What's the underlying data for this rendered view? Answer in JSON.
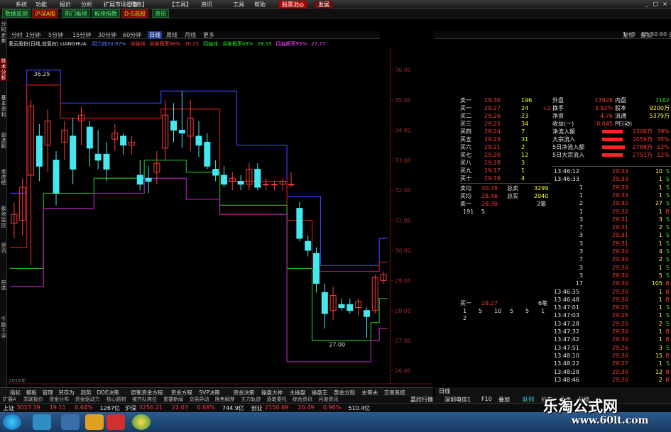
{
  "menubar": {
    "items": [
      "系统",
      "功能",
      "报价",
      "分析",
      "扩展市场行情",
      "【信息】",
      "【工具】",
      "资讯",
      "工具",
      "帮助"
    ],
    "promo": "股票池◎",
    "promo2": "发展"
  },
  "toolbar": {
    "items": [
      {
        "label": "数据监测",
        "style": "green"
      },
      {
        "label": "沪深A股",
        "style": "red"
      },
      {
        "label": "热门板块",
        "style": "green"
      },
      {
        "label": "板块指数",
        "style": "green"
      },
      {
        "label": "D-S选股",
        "style": "red"
      },
      {
        "label": "资讯",
        "style": "green"
      }
    ]
  },
  "left_tabs": [
    "分时走势",
    "技术分析",
    "基本资料",
    "自选股",
    "龙虎榜",
    "板块监控",
    "资讯",
    "自选",
    "千股千评"
  ],
  "periods": [
    "分时",
    "1分钟",
    "5分钟",
    "15分钟",
    "30分钟",
    "60分钟",
    "日线",
    "周线",
    "月线",
    "更多"
  ],
  "selected_period": "日线",
  "right_toolbar": [
    "1",
    "5",
    "15",
    "30",
    "60",
    "日",
    "周",
    "月",
    "复权",
    "叠加"
  ],
  "info": {
    "name": "爱云股份(日线,前复权) LIANGHUA",
    "indicators": [
      {
        "text": "阻力线30.97%",
        "color": "#5e78ff"
      },
      {
        "text": "突破线",
        "color": "#ff3b3b"
      },
      {
        "text": "突破概率68%",
        "color": "#ff3b3b"
      },
      {
        "text": "30.25",
        "color": "#ff3b3b"
      },
      {
        "text": "回抽线",
        "color": "#27e327"
      },
      {
        "text": "突破概率68%",
        "color": "#27e327"
      },
      {
        "text": "28.35",
        "color": "#27e327"
      },
      {
        "text": "回抽概率95%",
        "color": "#ff45ff"
      },
      {
        "text": "27.77",
        "color": "#ff45ff"
      }
    ]
  },
  "chart_data": {
    "type": "candlestick",
    "y_ticks": [
      "36.00",
      "35.00",
      "34.00",
      "33.00",
      "32.00",
      "31.00",
      "30.00",
      "29.00",
      "28.00",
      "27.00",
      "26.00"
    ],
    "ylim": [
      25.8,
      36.7
    ],
    "annotations": [
      {
        "text": "36.25"
      },
      {
        "text": "27.00"
      }
    ],
    "date_label": "2016年",
    "candles": [
      {
        "o": 30.9,
        "h": 31.6,
        "l": 30.4,
        "c": 31.2
      },
      {
        "o": 31.0,
        "h": 32.4,
        "l": 30.5,
        "c": 32.1
      },
      {
        "o": 32.5,
        "h": 35.0,
        "l": 29.5,
        "c": 34.8
      },
      {
        "o": 33.8,
        "h": 34.2,
        "l": 32.3,
        "c": 32.8
      },
      {
        "o": 33.5,
        "h": 34.7,
        "l": 32.6,
        "c": 34.3
      },
      {
        "o": 33.0,
        "h": 33.3,
        "l": 31.5,
        "c": 31.9
      },
      {
        "o": 33.6,
        "h": 34.3,
        "l": 33.0,
        "c": 34.0
      },
      {
        "o": 33.8,
        "h": 34.4,
        "l": 32.2,
        "c": 32.7
      },
      {
        "o": 34.3,
        "h": 34.8,
        "l": 33.5,
        "c": 34.5
      },
      {
        "o": 34.1,
        "h": 34.3,
        "l": 32.8,
        "c": 33.4
      },
      {
        "o": 33.2,
        "h": 34.0,
        "l": 32.7,
        "c": 33.0
      },
      {
        "o": 33.2,
        "h": 33.6,
        "l": 32.3,
        "c": 32.7
      },
      {
        "o": 33.7,
        "h": 34.2,
        "l": 33.3,
        "c": 33.9
      },
      {
        "o": 33.8,
        "h": 33.9,
        "l": 33.2,
        "c": 33.5
      },
      {
        "o": 33.5,
        "h": 33.8,
        "l": 33.2,
        "c": 33.6
      },
      {
        "o": 32.5,
        "h": 33.0,
        "l": 32.0,
        "c": 32.2
      },
      {
        "o": 32.4,
        "h": 32.8,
        "l": 31.9,
        "c": 32.3
      },
      {
        "o": 32.6,
        "h": 33.3,
        "l": 32.2,
        "c": 32.9
      },
      {
        "o": 33.4,
        "h": 35.0,
        "l": 33.0,
        "c": 34.5
      },
      {
        "o": 34.3,
        "h": 34.9,
        "l": 33.6,
        "c": 34.0
      },
      {
        "o": 34.0,
        "h": 35.3,
        "l": 33.4,
        "c": 33.9
      },
      {
        "o": 33.8,
        "h": 35.0,
        "l": 33.3,
        "c": 34.4
      },
      {
        "o": 33.8,
        "h": 34.3,
        "l": 33.1,
        "c": 33.5
      },
      {
        "o": 33.6,
        "h": 33.9,
        "l": 32.7,
        "c": 32.8
      },
      {
        "o": 32.7,
        "h": 33.0,
        "l": 32.3,
        "c": 32.5
      },
      {
        "o": 32.5,
        "h": 32.8,
        "l": 32.1,
        "c": 32.2
      },
      {
        "o": 32.3,
        "h": 32.6,
        "l": 32.0,
        "c": 32.4
      },
      {
        "o": 32.3,
        "h": 32.5,
        "l": 32.0,
        "c": 32.2
      },
      {
        "o": 32.2,
        "h": 32.9,
        "l": 32.0,
        "c": 32.7
      },
      {
        "o": 32.7,
        "h": 32.9,
        "l": 32.0,
        "c": 32.1
      },
      {
        "o": 32.2,
        "h": 32.4,
        "l": 32.0,
        "c": 32.2
      },
      {
        "o": 32.2,
        "h": 32.3,
        "l": 32.0,
        "c": 32.2
      },
      {
        "o": 32.2,
        "h": 32.4,
        "l": 32.0,
        "c": 32.3
      },
      {
        "o": 32.2,
        "h": 32.6,
        "l": 32.1,
        "c": 32.2
      },
      {
        "o": 31.4,
        "h": 31.6,
        "l": 30.3,
        "c": 30.4
      },
      {
        "o": 30.3,
        "h": 30.5,
        "l": 29.8,
        "c": 30.0
      },
      {
        "o": 29.9,
        "h": 30.1,
        "l": 28.6,
        "c": 28.9
      },
      {
        "o": 28.6,
        "h": 28.9,
        "l": 27.4,
        "c": 27.9
      },
      {
        "o": 28.0,
        "h": 28.8,
        "l": 27.7,
        "c": 28.5
      },
      {
        "o": 28.2,
        "h": 28.4,
        "l": 28.0,
        "c": 28.1
      },
      {
        "o": 28.2,
        "h": 28.4,
        "l": 27.9,
        "c": 28.0
      },
      {
        "o": 28.1,
        "h": 28.4,
        "l": 27.8,
        "c": 28.3
      },
      {
        "o": 28.0,
        "h": 28.1,
        "l": 27.1,
        "c": 27.8
      },
      {
        "o": 28.0,
        "h": 29.2,
        "l": 27.9,
        "c": 29.1
      },
      {
        "o": 29.0,
        "h": 29.3,
        "l": 28.9,
        "c": 29.2
      }
    ],
    "series": [
      {
        "name": "阻力线",
        "color": "#3c3cff",
        "values": [
          31.9,
          31.9,
          36.0,
          36.0,
          36.0,
          36.0,
          34.9,
          34.9,
          34.9,
          34.9,
          34.9,
          34.9,
          34.9,
          34.9,
          34.9,
          34.9,
          34.9,
          34.9,
          35.3,
          35.3,
          35.3,
          35.3,
          35.3,
          35.3,
          35.3,
          35.3,
          35.3,
          33.5,
          33.5,
          33.5,
          33.5,
          33.5,
          33.5,
          31.8,
          31.8,
          31.8,
          31.8,
          29.5,
          29.5,
          29.5,
          29.5,
          29.5,
          29.5,
          29.5,
          30.4
        ]
      },
      {
        "name": "突破线",
        "color": "#c41818",
        "values": [
          30.1,
          30.1,
          35.5,
          35.5,
          35.5,
          35.5,
          34.4,
          34.4,
          34.4,
          34.4,
          34.4,
          34.4,
          34.4,
          34.4,
          34.4,
          34.4,
          34.4,
          34.4,
          34.7,
          34.7,
          34.7,
          34.7,
          34.7,
          34.7,
          34.7,
          32.3,
          32.3,
          32.3,
          32.3,
          32.3,
          32.3,
          32.3,
          32.3,
          31.0,
          31.0,
          31.0,
          29.3,
          29.3,
          29.3,
          29.3,
          29.3,
          29.3,
          29.3,
          29.3,
          29.6
        ]
      },
      {
        "name": "回抽线",
        "color": "#20b020",
        "values": [
          29.4,
          29.4,
          29.4,
          29.4,
          31.9,
          31.9,
          31.9,
          31.9,
          31.9,
          31.9,
          32.4,
          32.4,
          32.4,
          32.4,
          32.4,
          32.4,
          33.0,
          33.0,
          33.0,
          33.0,
          33.0,
          32.6,
          32.6,
          32.6,
          32.6,
          31.5,
          31.5,
          31.5,
          31.5,
          31.5,
          31.5,
          31.5,
          31.5,
          29.4,
          29.4,
          29.4,
          27.0,
          27.0,
          27.0,
          27.0,
          27.0,
          27.0,
          27.0,
          27.6,
          28.4
        ]
      },
      {
        "name": "回抽线2",
        "color": "#b020b0",
        "values": [
          28.8,
          28.8,
          28.8,
          28.8,
          31.4,
          31.4,
          31.4,
          31.4,
          31.4,
          31.4,
          31.9,
          31.9,
          31.9,
          31.9,
          31.9,
          31.9,
          32.4,
          32.4,
          32.4,
          32.4,
          32.4,
          31.7,
          31.7,
          31.7,
          31.7,
          31.2,
          31.2,
          31.2,
          31.2,
          31.2,
          31.2,
          31.2,
          31.2,
          26.3,
          26.3,
          26.3,
          26.3,
          26.3,
          26.3,
          26.3,
          26.3,
          26.3,
          26.3,
          27.0,
          27.4
        ]
      }
    ]
  },
  "orderbook": {
    "asks": [
      {
        "label": "卖一",
        "price": "29.30",
        "vol": "196",
        "chg": ""
      },
      {
        "label": "买一",
        "price": "29.27",
        "vol": "24",
        "chg": "+2"
      },
      {
        "label": "买二",
        "price": "29.26",
        "vol": "23",
        "chg": ""
      },
      {
        "label": "买三",
        "price": "29.25",
        "vol": "34",
        "chg": ""
      },
      {
        "label": "买四",
        "price": "29.24",
        "vol": "7",
        "chg": ""
      },
      {
        "label": "买五",
        "price": "29.23",
        "vol": "31",
        "chg": ""
      },
      {
        "label": "买六",
        "price": "29.21",
        "vol": "2",
        "chg": ""
      },
      {
        "label": "买七",
        "price": "29.20",
        "vol": "12",
        "chg": ""
      },
      {
        "label": "买八",
        "price": "29.18",
        "vol": "3",
        "chg": ""
      },
      {
        "label": "买九",
        "price": "29.17",
        "vol": "1",
        "chg": ""
      },
      {
        "label": "买十",
        "price": "29.16",
        "vol": "4",
        "chg": ""
      }
    ],
    "avg_sell": {
      "label": "卖均",
      "price": "30.78",
      "tlabel": "总卖",
      "vol": "3299"
    },
    "avg_buy": {
      "label": "买均",
      "price": "28.46",
      "tlabel": "总买",
      "vol": "2040"
    },
    "sell1": {
      "label": "卖一",
      "price": "29.30",
      "vol": "2笔"
    },
    "sell1_detail": [
      "191",
      "5"
    ],
    "buy1": {
      "label": "买一",
      "price": "29.27",
      "vol": "6笔"
    },
    "buy1_detail": [
      "1",
      "5",
      "10",
      "5",
      "5",
      "1",
      "2"
    ]
  },
  "stats": {
    "rows": [
      {
        "k1": "外盘",
        "v1": "13928",
        "k2": "内盘",
        "v2": "7162"
      },
      {
        "k1": "换手",
        "v1": "3.92%",
        "k2": "股本",
        "v2": "9200万"
      },
      {
        "k1": "净资",
        "v1": "4.76",
        "k2": "流通",
        "v2": "5379万"
      },
      {
        "k1": "收益(一)",
        "v1": "-0.045",
        "k2": "PE(动)",
        "v2": ""
      }
    ],
    "flows": [
      {
        "label": "净流入额",
        "bar": 0.18,
        "val": "2306万",
        "pct": "39%"
      },
      {
        "label": "大宗流入",
        "bar": 0.18,
        "val": "2059万",
        "pct": "35%"
      },
      {
        "label": "5日净流入额",
        "bar": 0.2,
        "val": "2788万",
        "pct": "12%"
      },
      {
        "label": "5日大宗流入",
        "bar": 0.18,
        "val": "2751万",
        "pct": "12%"
      }
    ]
  },
  "ticks": [
    {
      "t": "13:46:12",
      "p": "29.33",
      "v": "10",
      "f": "S",
      "pc": "red"
    },
    {
      "t": "13:46:33",
      "p": "29.33",
      "v": "1",
      "f": "S",
      "pc": "red"
    },
    {
      "t": "1",
      "p": "29.33",
      "v": "1",
      "f": "S",
      "pc": "red"
    },
    {
      "t": "1",
      "p": "29.33",
      "v": "1",
      "f": "S",
      "pc": "red"
    },
    {
      "t": "2",
      "p": "29.32",
      "v": "27",
      "f": "S",
      "pc": "red"
    },
    {
      "t": "1",
      "p": "29.32",
      "v": "1",
      "f": "B",
      "pc": "red"
    },
    {
      "t": "3",
      "p": "29.31",
      "v": "3",
      "f": "S",
      "pc": "red"
    },
    {
      "t": "7",
      "p": "29.31",
      "v": "2",
      "f": "S",
      "pc": "red"
    },
    {
      "t": "3",
      "p": "29.31",
      "v": "1",
      "f": "S",
      "pc": "red"
    },
    {
      "t": "3",
      "p": "29.31",
      "v": "1",
      "f": "S",
      "pc": "red"
    },
    {
      "t": "3",
      "p": "29.30",
      "v": "4",
      "f": "S",
      "pc": "red"
    },
    {
      "t": "7",
      "p": "29.30",
      "v": "2",
      "f": "S",
      "pc": "red"
    },
    {
      "t": "3",
      "p": "29.30",
      "v": "1",
      "f": "S",
      "pc": "red"
    },
    {
      "t": "3",
      "p": "29.30",
      "v": "5",
      "f": "S",
      "pc": "red"
    },
    {
      "t": "17",
      "p": "29.30",
      "v": "105",
      "f": "B",
      "pc": "red"
    },
    {
      "t": "13:46:35",
      "p": "29.30",
      "v": "1",
      "f": "B",
      "pc": "red"
    },
    {
      "t": "13:46:48",
      "p": "29.30",
      "v": "1",
      "f": "B",
      "pc": "red"
    },
    {
      "t": "13:47:01",
      "p": "29.25",
      "v": "1",
      "f": "S",
      "pc": "red"
    },
    {
      "t": "13:47:03",
      "p": "29.25",
      "v": "1",
      "f": "S",
      "pc": "red"
    },
    {
      "t": "13:47:28",
      "p": "29.25",
      "v": "2",
      "f": "S",
      "pc": "red"
    },
    {
      "t": "13:47:32",
      "p": "29.30",
      "v": "1",
      "f": "B",
      "pc": "red"
    },
    {
      "t": "13:47:42",
      "p": "29.30",
      "v": "1",
      "f": "B",
      "pc": "red"
    },
    {
      "t": "13:47:51",
      "p": "29.26",
      "v": "3",
      "f": "S",
      "pc": "red"
    },
    {
      "t": "13:48:10",
      "p": "29.30",
      "v": "15",
      "f": "B",
      "pc": "red"
    },
    {
      "t": "13:48:22",
      "p": "29.27",
      "v": "1",
      "f": "S",
      "pc": "red"
    },
    {
      "t": "13:48:28",
      "p": "29.30",
      "v": "12",
      "f": "B",
      "pc": "red"
    },
    {
      "t": "13:48:46",
      "p": "29.30",
      "v": "2",
      "f": "B",
      "pc": "red"
    }
  ],
  "bottom_tabs": [
    "指标",
    "模板",
    "管理",
    "另存为",
    "趋势",
    "DDE决策",
    "原衡资金方程",
    "资金方程",
    "SVP决策",
    "资金决策",
    "操盘大神",
    "主操盘",
    "操盘王",
    "黄金分割",
    "史蒂夫",
    "交易系统"
  ],
  "bottom_tabs2": [
    "扩展A",
    "关联报价",
    "资金分布",
    "资金驱动力",
    "核心题材",
    "被齐队席位",
    "重要新闻",
    "交易异动",
    "限售解禁",
    "主力轨迹",
    "逐笔委托",
    "综合资讯",
    "问道资讯"
  ],
  "right_bottom": {
    "period": "日线",
    "tabs": [
      "嘉欣行情",
      "深圳电信1"
    ],
    "switches": [
      "F10",
      "叠加"
    ],
    "sub": [
      "队列",
      "分布",
      "龙虎",
      "分档"
    ]
  },
  "index_bar": [
    {
      "text": "上证",
      "c": "wht"
    },
    {
      "text": "3023.39",
      "c": "red"
    },
    {
      "text": "19.11",
      "c": "red"
    },
    {
      "text": "0.64%",
      "c": "red"
    },
    {
      "text": "1267亿",
      "c": "wht"
    },
    {
      "text": "沪深",
      "c": "wht"
    },
    {
      "text": "3256.21",
      "c": "red"
    },
    {
      "text": "22.03",
      "c": "red"
    },
    {
      "text": "0.68%",
      "c": "red"
    },
    {
      "text": "744.9亿",
      "c": "wht"
    },
    {
      "text": "创业",
      "c": "wht"
    },
    {
      "text": "2150.69",
      "c": "red"
    },
    {
      "text": "20.49",
      "c": "red"
    },
    {
      "text": "0.96%",
      "c": "red"
    },
    {
      "text": "510.4亿",
      "c": "wht"
    }
  ],
  "watermark": {
    "line1": "乐淘公式网",
    "line2": "www.60lt.com"
  }
}
